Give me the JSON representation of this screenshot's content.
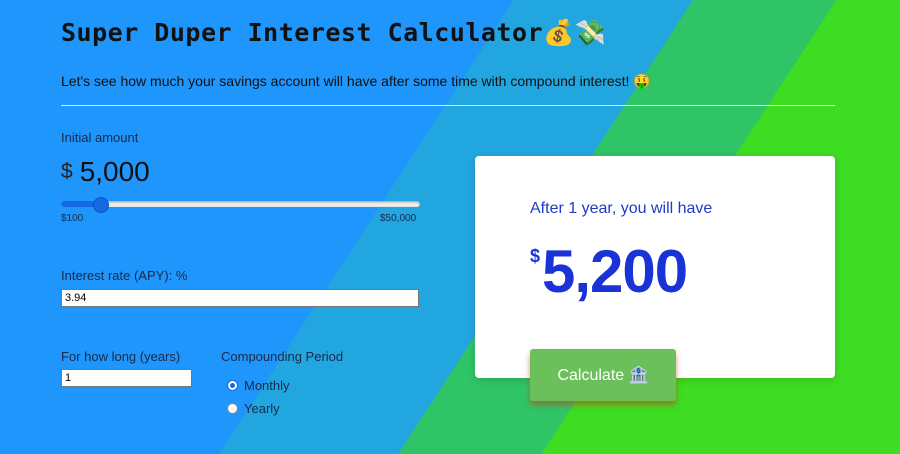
{
  "header": {
    "title": "Super Duper Interest Calculator💰💸",
    "subtitle": "Let's see how much your savings account will have after some time with compound interest! 🤑"
  },
  "initial_amount": {
    "label": "Initial amount",
    "currency_symbol": "$",
    "value": "5,000",
    "slider": {
      "min_label": "$100",
      "max_label": "$50,000",
      "min": 100,
      "max": 50000,
      "value": 5000
    }
  },
  "interest_rate": {
    "label": "Interest rate (APY): %",
    "value": "3.94"
  },
  "duration": {
    "label": "For how long (years)",
    "value": "1"
  },
  "compounding": {
    "label": "Compounding Period",
    "options": [
      {
        "label": "Monthly",
        "checked": true
      },
      {
        "label": "Yearly",
        "checked": false
      }
    ]
  },
  "result": {
    "label": "After 1 year, you will have",
    "currency_symbol": "$",
    "value": "5,200"
  },
  "calculate_button": {
    "label": "Calculate 🏦"
  },
  "colors": {
    "accent": "#1668e3",
    "result_text": "#1a33d6",
    "button": "#6cc05c"
  }
}
